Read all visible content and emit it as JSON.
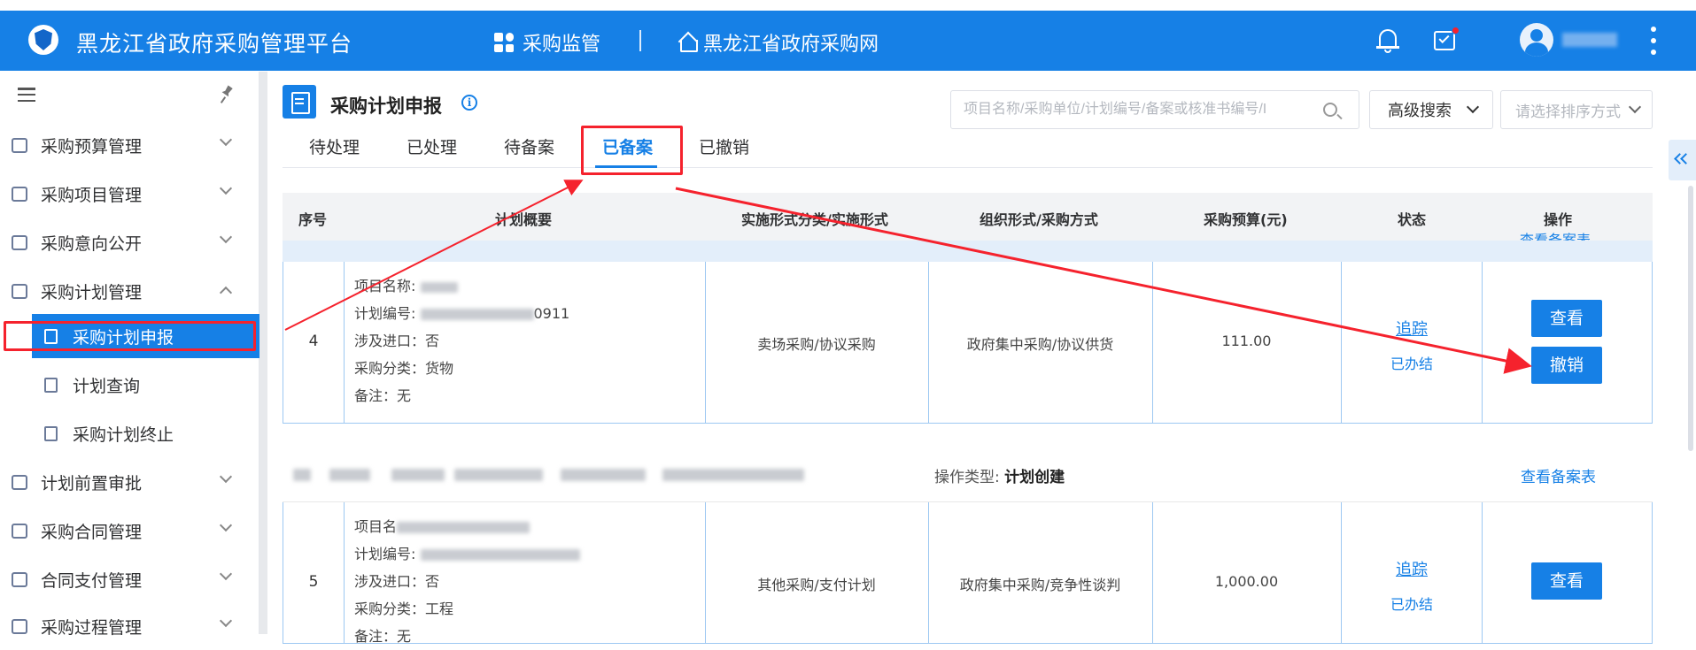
{
  "header": {
    "app_title": "黑龙江省政府采购管理平台",
    "nav_supervision": "采购监管",
    "nav_portal": "黑龙江省政府采购网",
    "brand_color": "#1680e6"
  },
  "sidebar": {
    "items": [
      {
        "label": "采购预算管理",
        "icon": "chart-icon"
      },
      {
        "label": "采购项目管理",
        "icon": "camera-icon"
      },
      {
        "label": "采购意向公开",
        "icon": "document-icon"
      },
      {
        "label": "采购计划管理",
        "icon": "calendar-icon"
      },
      {
        "label": "计划前置审批",
        "icon": "stamp-icon"
      },
      {
        "label": "采购合同管理",
        "icon": "folder-icon"
      },
      {
        "label": "合同支付管理",
        "icon": "payment-icon"
      },
      {
        "label": "采购过程管理",
        "icon": "process-icon"
      }
    ],
    "sub_items": [
      {
        "label": "采购计划申报",
        "active": true
      },
      {
        "label": "计划查询",
        "active": false
      },
      {
        "label": "采购计划终止",
        "active": false
      }
    ]
  },
  "page": {
    "title": "采购计划申报",
    "search_placeholder": "项目名称/采购单位/计划编号/备案或核准书编号/I",
    "advanced_search": "高级搜索",
    "sort_placeholder": "请选择排序方式"
  },
  "tabs": [
    "待处理",
    "已处理",
    "待备案",
    "已备案",
    "已撤销"
  ],
  "active_tab": "已备案",
  "table": {
    "headers": [
      "序号",
      "计划概要",
      "实施形式分类/实施形式",
      "组织形式/采购方式",
      "采购预算(元)",
      "状态",
      "操作"
    ],
    "strip_link": "查看备案表",
    "rows": [
      {
        "num": "4",
        "project_name_label": "项目名称:",
        "plan_no_label": "计划编号:",
        "plan_no_tail": "0911",
        "import_line": "涉及进口：否",
        "category_line": "采购分类：货物",
        "remark_line": "备注：无",
        "impl_form": "卖场采购/协议采购",
        "org_form": "政府集中采购/协议供货",
        "budget": "111.00",
        "track": "追踪",
        "status": "已办结",
        "view_btn": "查看",
        "revoke_btn": "撤销"
      },
      {
        "num": "5",
        "project_name_label": "项目名",
        "plan_no_label": "计划编号:",
        "import_line": "涉及进口：否",
        "category_line": "采购分类：工程",
        "remark_line": "备注：无",
        "impl_form": "其他采购/支付计划",
        "org_form": "政府集中采购/竞争性谈判",
        "budget": "1,000.00",
        "track": "追踪",
        "status": "已办结",
        "view_btn": "查看"
      }
    ]
  },
  "group2": {
    "op_type_label": "操作类型:",
    "op_type_value": "计划创建",
    "view_filing": "查看备案表"
  },
  "annotation_color": "#f5222d"
}
